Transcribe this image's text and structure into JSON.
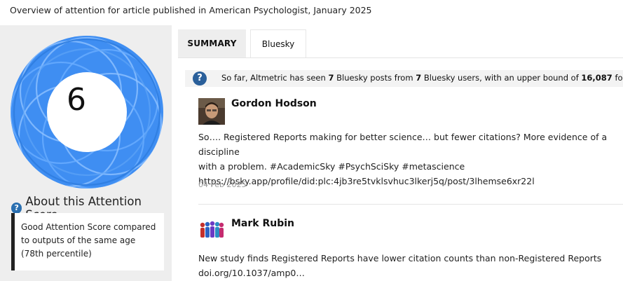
{
  "header": {
    "overview": "Overview of attention for article published in American Psychologist, January 2025"
  },
  "score": {
    "value": "6",
    "about_title": "About this Attention Score",
    "description": "Good Attention Score compared to outputs of the same age (78th percentile)",
    "ring_color": "#3e8ef0"
  },
  "tabs": [
    {
      "label": "SUMMARY",
      "active": false
    },
    {
      "label": "Bluesky",
      "active": true
    }
  ],
  "info": {
    "prefix": "So far, Altmetric has seen ",
    "posts_count": "7",
    "middle1": " Bluesky posts from ",
    "users_count": "7",
    "middle2": " Bluesky users, with an upper bound of ",
    "followers": "16,087",
    "suffix": " followers."
  },
  "posts": [
    {
      "author": "Gordon Hodson",
      "text_line1": "So…. Registered Reports making for better science… but fewer citations? More evidence of a discipline",
      "text_line2": "with a problem. #AcademicSky #PsychSciSky #metascience",
      "text_line3": "https://bsky.app/profile/did:plc:4jb3re5tvklsvhuc3lkerj5q/post/3lhemse6xr22l",
      "date": "04 Feb 2025"
    },
    {
      "author": "Mark Rubin",
      "text_line1": "New study finds Registered Reports have lower citation counts than non-Registered Reports",
      "text_line2": "doi.org/10.1037/amp0…"
    }
  ]
}
